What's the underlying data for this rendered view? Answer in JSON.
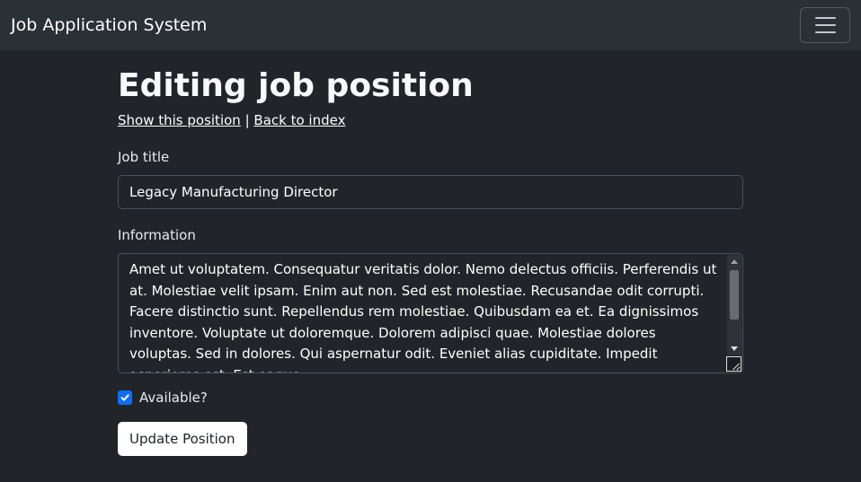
{
  "navbar": {
    "brand": "Job Application System",
    "toggler_icon": "hamburger-menu-icon"
  },
  "page": {
    "title": "Editing job position",
    "show_link": "Show this position",
    "separator": "|",
    "back_link": "Back to index"
  },
  "form": {
    "job_title_label": "Job title",
    "job_title_value": "Legacy Manufacturing Director",
    "information_label": "Information",
    "information_value": "Amet ut voluptatem. Consequatur veritatis dolor. Nemo delectus officiis. Perferendis ut at. Molestiae velit ipsam. Enim aut non. Sed est molestiae. Recusandae odit corrupti. Facere distinctio sunt. Repellendus rem molestiae. Quibusdam ea et. Ea dignissimos inventore. Voluptate ut doloremque. Dolorem adipisci quae. Molestiae dolores voluptas. Sed in dolores. Qui aspernatur odit. Eveniet alias cupiditate. Impedit asperiores est. Est eaque",
    "available_label": "Available?",
    "available_checked": true,
    "submit_label": "Update Position"
  },
  "colors": {
    "background": "#212529",
    "navbar": "#2b3035",
    "checkbox_accent": "#0d6efd"
  }
}
